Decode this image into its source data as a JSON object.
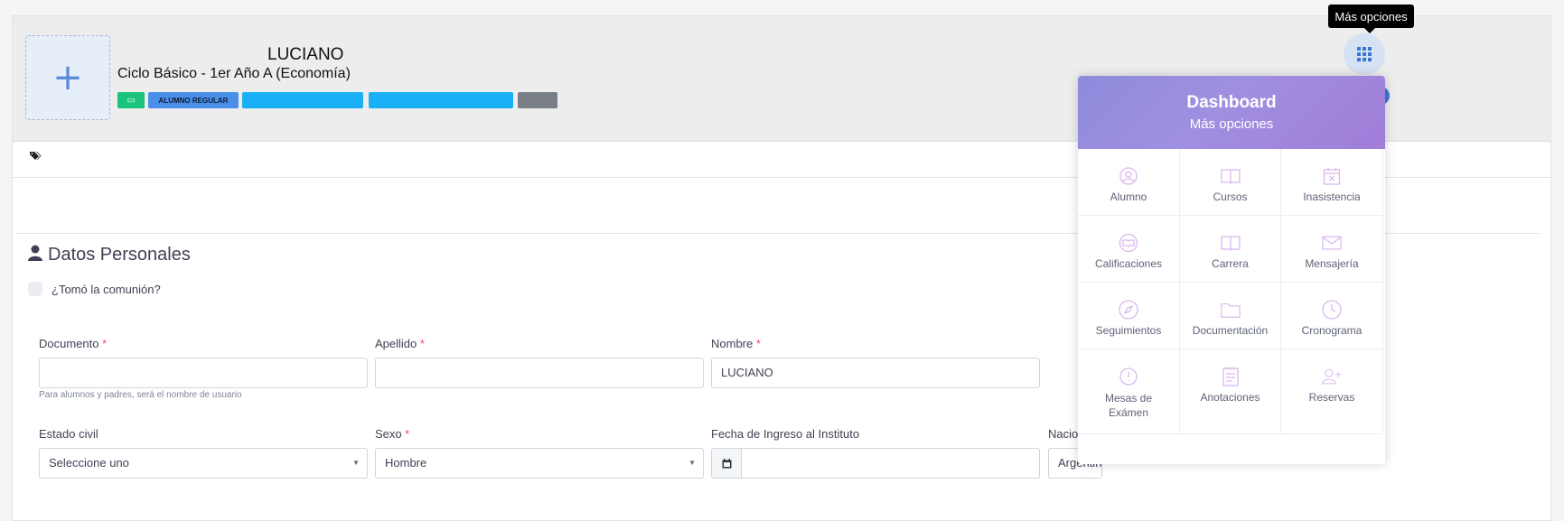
{
  "header": {
    "avatar_symbol": "+",
    "student_name": "LUCIANO",
    "course": "Ciclo Básico - 1er Año A (Economía)",
    "badge_regular": "ALUMNO REGULAR"
  },
  "section": {
    "title": "Datos Personales"
  },
  "form": {
    "communion_label": "¿Tomó la comunión?",
    "documento_label": "Documento",
    "documento_value": "",
    "documento_help": "Para alumnos y padres, será el nombre de usuario",
    "apellido_label": "Apellido",
    "apellido_value": "",
    "nombre_label": "Nombre",
    "nombre_value": "LUCIANO",
    "required_mark": "*",
    "estado_civil_label": "Estado civil",
    "estado_civil_value": "Seleccione uno",
    "sexo_label": "Sexo",
    "sexo_value": "Hombre",
    "fecha_label": "Fecha de Ingreso al Instituto",
    "nacionalidad_label": "Nacio",
    "nacionalidad_value": "Argentino"
  },
  "tooltip": "Más opciones",
  "dropdown": {
    "title": "Dashboard",
    "subtitle": "Más opciones",
    "items": [
      {
        "label": "Alumno",
        "icon": "user-circle-icon"
      },
      {
        "label": "Cursos",
        "icon": "book-open-icon"
      },
      {
        "label": "Inasistencia",
        "icon": "calendar-x-icon"
      },
      {
        "label": "Calificaciones",
        "icon": "grades-icon"
      },
      {
        "label": "Carrera",
        "icon": "book-icon"
      },
      {
        "label": "Mensajería",
        "icon": "envelope-icon"
      },
      {
        "label": "Seguimientos",
        "icon": "compass-icon"
      },
      {
        "label": "Documentación",
        "icon": "folder-icon"
      },
      {
        "label": "Cronograma",
        "icon": "clock-icon"
      },
      {
        "label": "Mesas de Exámen",
        "icon": "info-circle-icon"
      },
      {
        "label": "Anotaciones",
        "icon": "notepad-icon"
      },
      {
        "label": "Reservas",
        "icon": "user-plus-icon"
      }
    ]
  },
  "colors": {
    "accent": "#3c76d4",
    "badge_blue": "#4a90e8",
    "badge_cyan": "#1ab0f5",
    "badge_green": "#1bc47d",
    "required": "#f64e60"
  }
}
